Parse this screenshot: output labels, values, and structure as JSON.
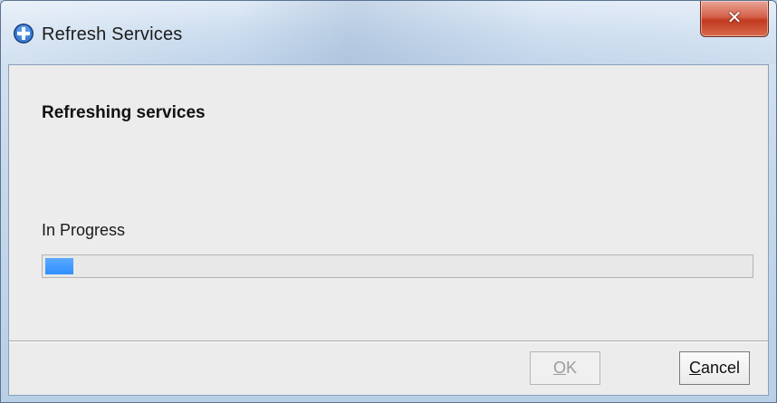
{
  "window": {
    "title": "Refresh Services"
  },
  "content": {
    "heading": "Refreshing services",
    "status_label": "In Progress",
    "progress": 0.04
  },
  "buttons": {
    "ok": {
      "mnemonic": "O",
      "rest": "K",
      "enabled": false
    },
    "cancel": {
      "mnemonic": "C",
      "rest": "ancel",
      "enabled": true
    }
  },
  "icons": {
    "app": "blue-plus-circle-icon",
    "close": "close-icon"
  },
  "colors": {
    "progress_fill": "#2f8fff",
    "close_button": "#c23a1f"
  }
}
